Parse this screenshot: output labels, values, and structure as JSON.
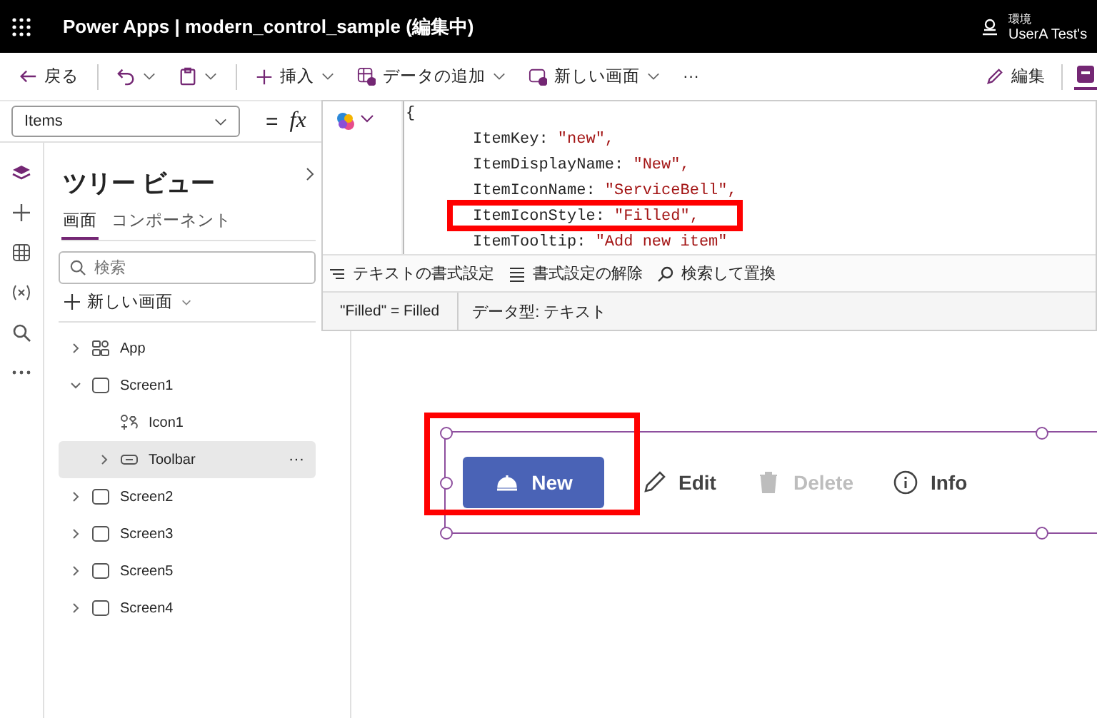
{
  "window": {
    "title": "Power Apps | modern_control_sample (編集中)",
    "environment_label": "環境",
    "user": "UserA Test's"
  },
  "command_bar": {
    "back": "戻る",
    "insert": "挿入",
    "add_data": "データの追加",
    "new_screen": "新しい画面",
    "more": "···",
    "edit": "編集"
  },
  "formula_bar": {
    "property": "Items",
    "equals": "=",
    "fx": "fx",
    "code_lines": [
      {
        "key": "{"
      },
      {
        "key": "ItemKey: ",
        "value": "\"new\","
      },
      {
        "key": "ItemDisplayName: ",
        "value": "\"New\","
      },
      {
        "key": "ItemIconName: ",
        "value": "\"ServiceBell\","
      },
      {
        "key": "ItemIconStyle: ",
        "value": "\"Filled\","
      },
      {
        "key": "ItemTooltip: ",
        "value": "\"Add new item\""
      }
    ],
    "tools": [
      "テキストの書式設定",
      "書式設定の解除",
      "検索して置換"
    ],
    "result": "\"Filled\"  =  Filled",
    "data_type": "データ型: テキスト"
  },
  "tree_view": {
    "title": "ツリー ビュー",
    "tabs": [
      {
        "label": "画面",
        "selected": true
      },
      {
        "label": "コンポーネント",
        "selected": false
      }
    ],
    "search": {
      "placeholder": "検索"
    },
    "new_screen": "新しい画面",
    "items": [
      {
        "label": "App",
        "kind": "app",
        "expanded": false,
        "selected": false
      },
      {
        "label": "Screen1",
        "kind": "screen",
        "expanded": true,
        "selected": false,
        "children": [
          {
            "label": "Icon1",
            "kind": "icon",
            "expanded": false,
            "selected": false
          },
          {
            "label": "Toolbar",
            "kind": "toolbar",
            "expanded": false,
            "selected": true
          }
        ]
      },
      {
        "label": "Screen2",
        "kind": "screen",
        "expanded": false,
        "selected": false
      },
      {
        "label": "Screen3",
        "kind": "screen",
        "expanded": false,
        "selected": false
      },
      {
        "label": "Screen5",
        "kind": "screen",
        "expanded": false,
        "selected": false
      },
      {
        "label": "Screen4",
        "kind": "screen",
        "expanded": false,
        "selected": false
      }
    ]
  },
  "toolbar": {
    "items": [
      {
        "label": "New",
        "primary": true,
        "disabled": false
      },
      {
        "label": "Edit",
        "primary": false,
        "disabled": false
      },
      {
        "label": "Delete",
        "primary": false,
        "disabled": true
      },
      {
        "label": "Info",
        "primary": false,
        "disabled": false
      }
    ]
  }
}
